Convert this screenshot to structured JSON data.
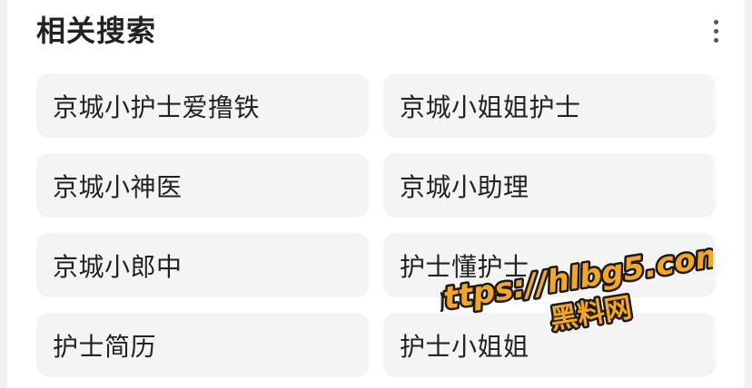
{
  "section": {
    "title": "相关搜索",
    "more_icon": "more-vertical-icon"
  },
  "searches": [
    {
      "label": "京城小护士爱撸铁"
    },
    {
      "label": "京城小姐姐护士"
    },
    {
      "label": "京城小神医"
    },
    {
      "label": "京城小助理"
    },
    {
      "label": "京城小郎中"
    },
    {
      "label": "护士懂护士"
    },
    {
      "label": "护士简历"
    },
    {
      "label": "护士小姐姐"
    }
  ],
  "watermark": {
    "url": "https://hlbg5.com",
    "name": "黑料网",
    "fill": "#f5a623",
    "outline": "#1a1a1a"
  }
}
